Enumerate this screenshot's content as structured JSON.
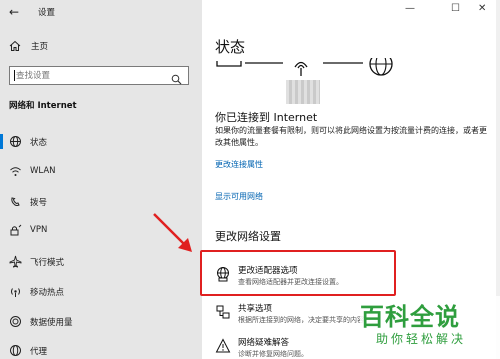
{
  "window": {
    "title": "设置",
    "back_icon": "back-arrow-icon",
    "controls": [
      "—",
      "☐",
      "✕"
    ]
  },
  "nav": {
    "home_label": "主页",
    "search_placeholder": "查找设置",
    "section_title": "网络和 Internet",
    "items": [
      {
        "label": "状态",
        "icon": "globe-icon",
        "active": true
      },
      {
        "label": "WLAN",
        "icon": "wifi-icon",
        "active": false
      },
      {
        "label": "拨号",
        "icon": "dialup-icon",
        "active": false
      },
      {
        "label": "VPN",
        "icon": "vpn-icon",
        "active": false
      },
      {
        "label": "飞行模式",
        "icon": "airplane-icon",
        "active": false
      },
      {
        "label": "移动热点",
        "icon": "hotspot-icon",
        "active": false
      },
      {
        "label": "数据使用量",
        "icon": "data-usage-icon",
        "active": false
      },
      {
        "label": "代理",
        "icon": "proxy-icon",
        "active": false
      }
    ]
  },
  "main": {
    "title": "状态",
    "connection_title": "你已连接到 Internet",
    "connection_desc": "如果你的流量套餐有限制，则可以将此网络设置为按流量计费的连接，或者更改其他属性。",
    "link_change_props": "更改连接属性",
    "link_show_networks": "显示可用网络",
    "change_settings_title": "更改网络设置",
    "options": [
      {
        "title": "更改适配器选项",
        "desc": "查看网络适配器并更改连接设置。",
        "icon": "adapter-icon"
      },
      {
        "title": "共享选项",
        "desc": "根据所连接到的网络，决定要共享的内容。",
        "icon": "sharing-icon"
      },
      {
        "title": "网络疑难解答",
        "desc": "诊断并修复网络问题。",
        "icon": "troubleshoot-icon"
      }
    ]
  },
  "overlay": {
    "highlight_color": "#e02020",
    "watermark_title": "百科全说",
    "watermark_subtitle": "助你轻松解决"
  }
}
